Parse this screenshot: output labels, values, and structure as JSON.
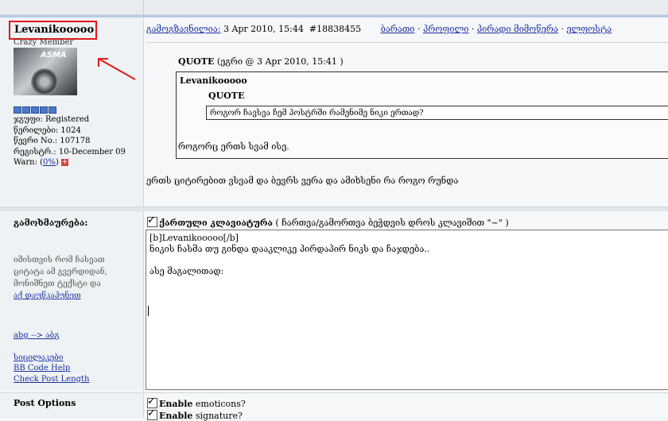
{
  "author": {
    "name": "Levanikooooo",
    "rank": "Crazy Member",
    "avatar_text": "ASMA",
    "stats": [
      "ჯგუფი: Registered",
      "წერილები: 1024",
      "წევრი No.: 107178",
      "რეგისტრ.: 10-December 09"
    ],
    "warn_label": "Warn: (",
    "warn_value": "0%",
    "warn_close": ")"
  },
  "post": {
    "meta_label": "გამოგზავნილია:",
    "meta_date": " 3 Apr 2010, 15:44",
    "meta_id": "#18838455",
    "links": [
      "ბარათი",
      "პროფილი",
      "პირადი მიმოწერა",
      "ელფოსტა"
    ],
    "link_sep": " · ",
    "quote_label": "QUOTE",
    "quote_source": " (ეგრი @ 3 Apr 2010, 15:41 )",
    "quote_author": "Levanikooooo",
    "inner_quote_label": "QUOTE",
    "inner_quote_text": "როგორ ჩავსვა ჩემ პოსტრში რამენიმე ნიკი ერთად?",
    "quote_body": "როგორც ერთს სვამ ისე.",
    "body": "ერთს ციტირებით ვსვამ და ბევრს ვერა და ამიხსენი რა როგო რუნდა"
  },
  "reply": {
    "title": "გამოხმაურება:",
    "help_text": "იმისთვის რომ ჩასვათ ციტატა ამ გვერდიდან, მონიშნეთ ტექსტი და",
    "help_link": "აქ დაუწკაპუნეთ",
    "abg_link": "abg --> აბგ",
    "smilies_link": "სიცილაკები",
    "bbcode_link": "BB Code Help",
    "check_length_link": "Check Post Length",
    "keyboard_label": "ქართული კლავიატურა",
    "keyboard_hint": " ( ჩართვა/გამორთვა ბეჭდვის დროს კლავიშით \"~\" )",
    "editor_text": "[b]Levanikooooo[/b]\nნიკის ჩასმა თუ გინდა დააკლიკე პირდაპირ ნიკს და ჩაჯდება..\n\nასე მაგალითად:"
  },
  "options": {
    "title": "Post Options",
    "emoticons_bold": "Enable",
    "emoticons_rest": " emoticons?",
    "signature_bold": "Enable",
    "signature_rest": " signature?"
  },
  "colors": {
    "highlight_box": "#e01a1a",
    "link": "#1b2fa0"
  }
}
